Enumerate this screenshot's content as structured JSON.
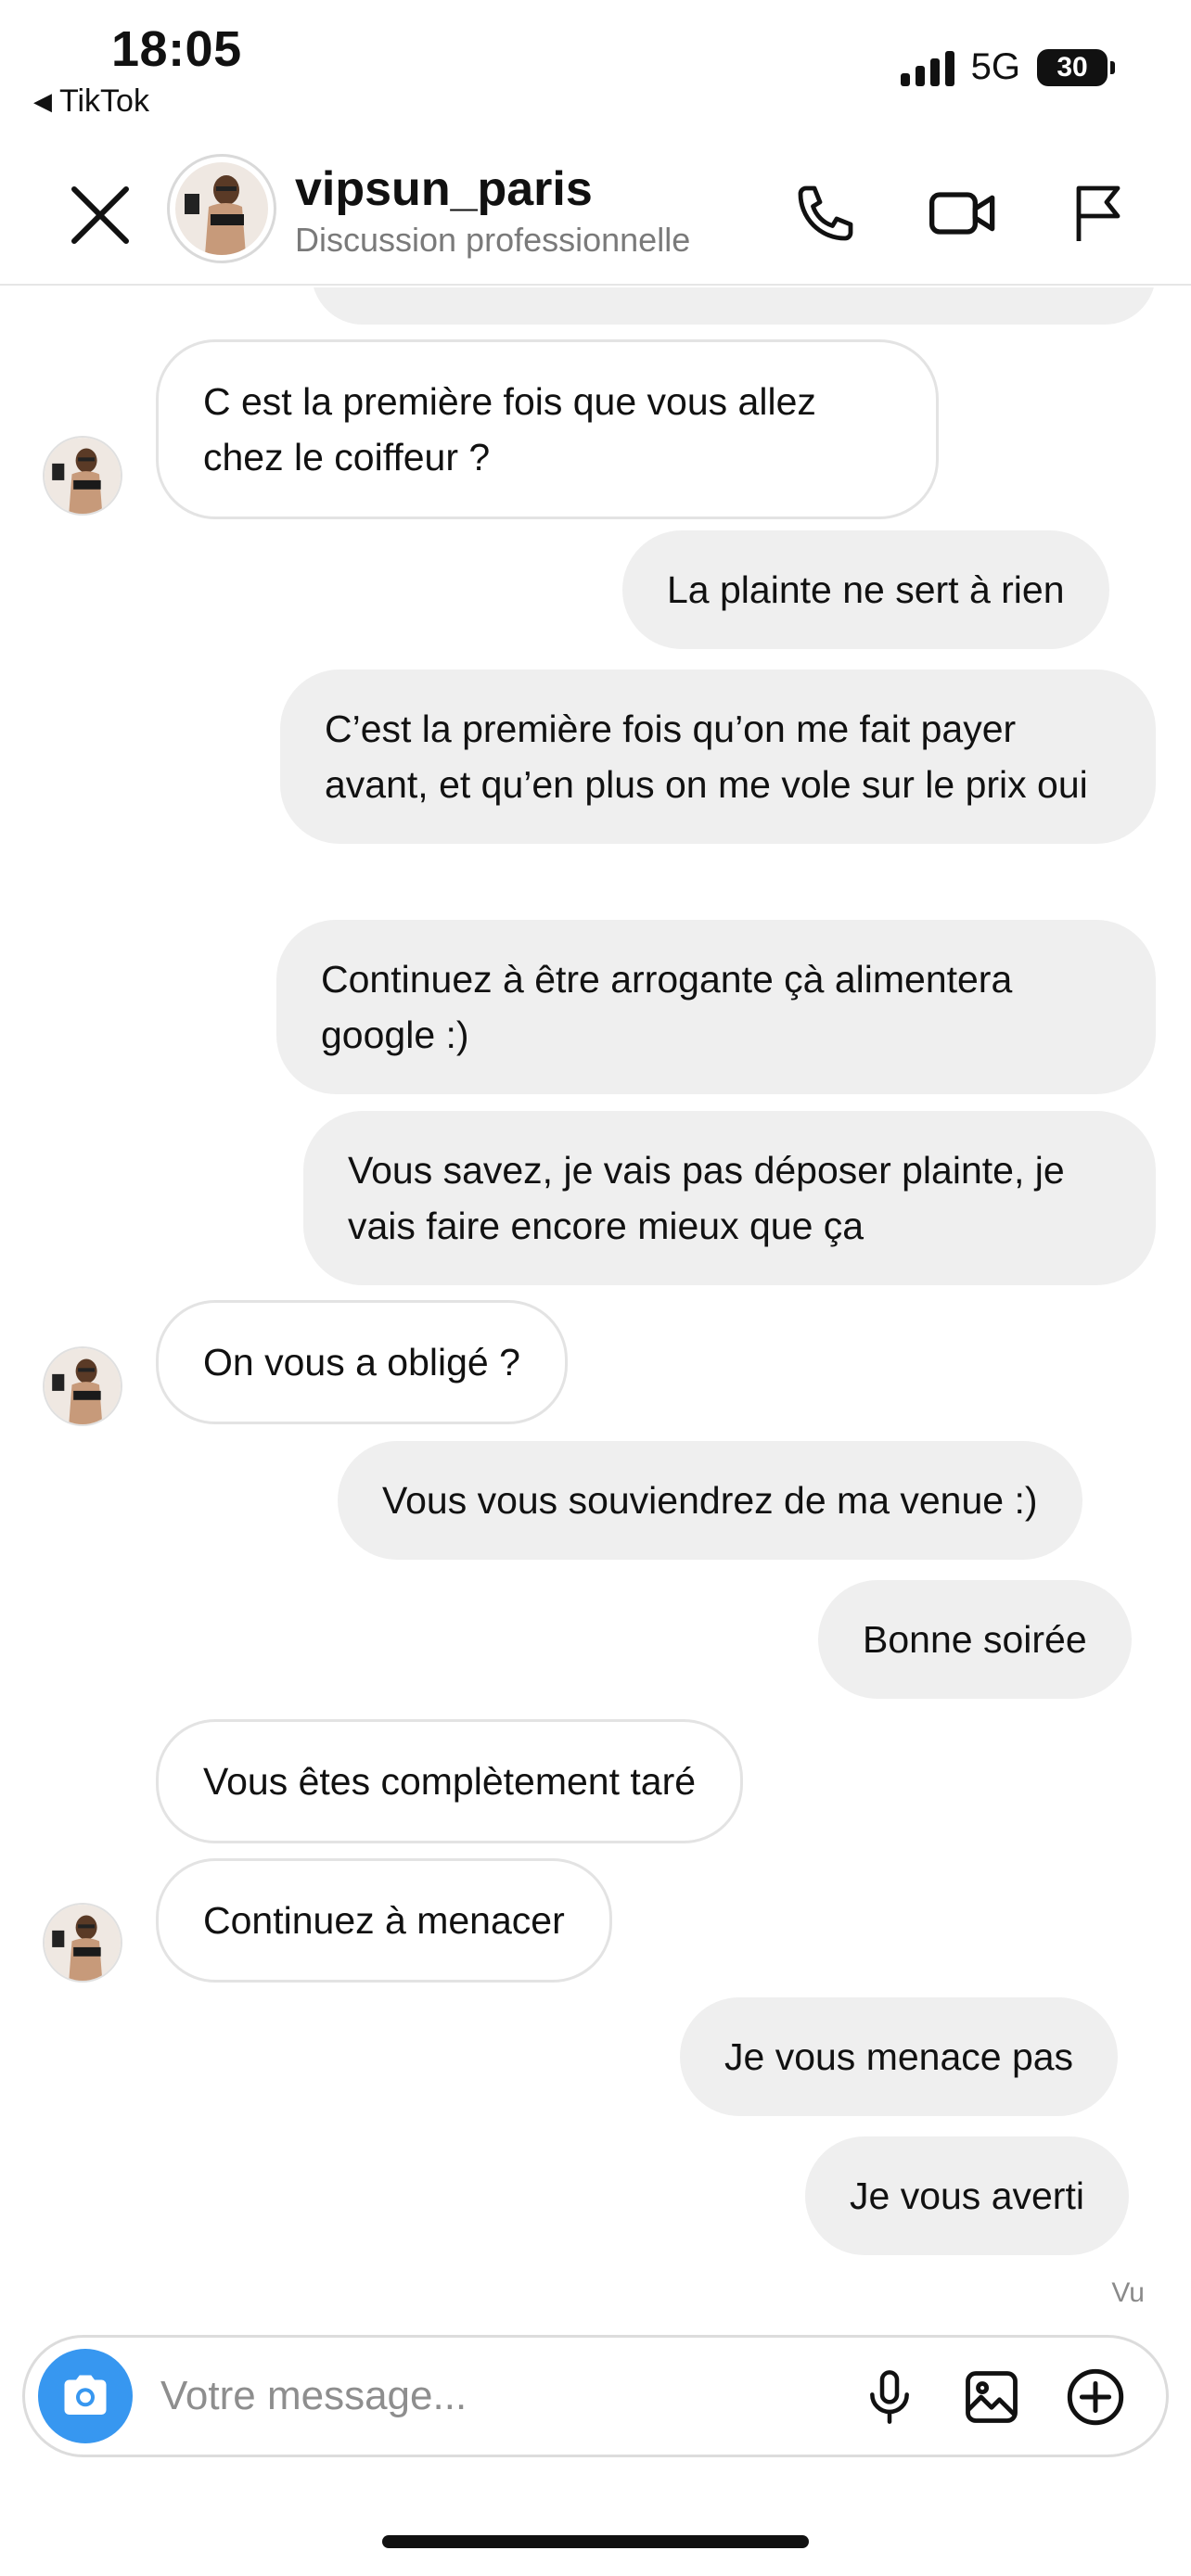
{
  "status_bar": {
    "time": "18:05",
    "back_app": "TikTok",
    "network": "5G",
    "battery": "30"
  },
  "header": {
    "contact_name": "vipsun_paris",
    "subtitle": "Discussion professionnelle"
  },
  "messages": [
    {
      "from": "them",
      "text": "C est la première fois que vous allez chez le coiffeur ?"
    },
    {
      "from": "me",
      "text": "La plainte ne sert à rien"
    },
    {
      "from": "me",
      "text": "C’est la première fois qu’on me fait payer avant, et qu’en plus on me vole sur le prix oui"
    },
    {
      "from": "me",
      "text": "Continuez à être arrogante çà alimentera google :)"
    },
    {
      "from": "me",
      "text": "Vous savez, je vais pas déposer plainte, je vais faire encore mieux que ça"
    },
    {
      "from": "them",
      "text": "On vous a obligé ?"
    },
    {
      "from": "me",
      "text": "Vous vous souviendrez de ma venue :)"
    },
    {
      "from": "me",
      "text": "Bonne soirée"
    },
    {
      "from": "them",
      "text": "Vous êtes complètement taré"
    },
    {
      "from": "them",
      "text": "Continuez à menacer"
    },
    {
      "from": "me",
      "text": "Je vous menace pas"
    },
    {
      "from": "me",
      "text": "Je vous averti"
    }
  ],
  "seen_label": "Vu",
  "composer": {
    "placeholder": "Votre message..."
  },
  "colors": {
    "accent": "#3797f0",
    "outgoing_bubble": "#efefef",
    "incoming_border": "#e3e3e3"
  },
  "icons": {
    "close": "close-icon",
    "call": "phone-icon",
    "video": "video-camera-icon",
    "report": "flag-icon",
    "camera": "camera-icon",
    "mic": "microphone-icon",
    "gallery": "image-icon",
    "more": "plus-circle-icon"
  }
}
